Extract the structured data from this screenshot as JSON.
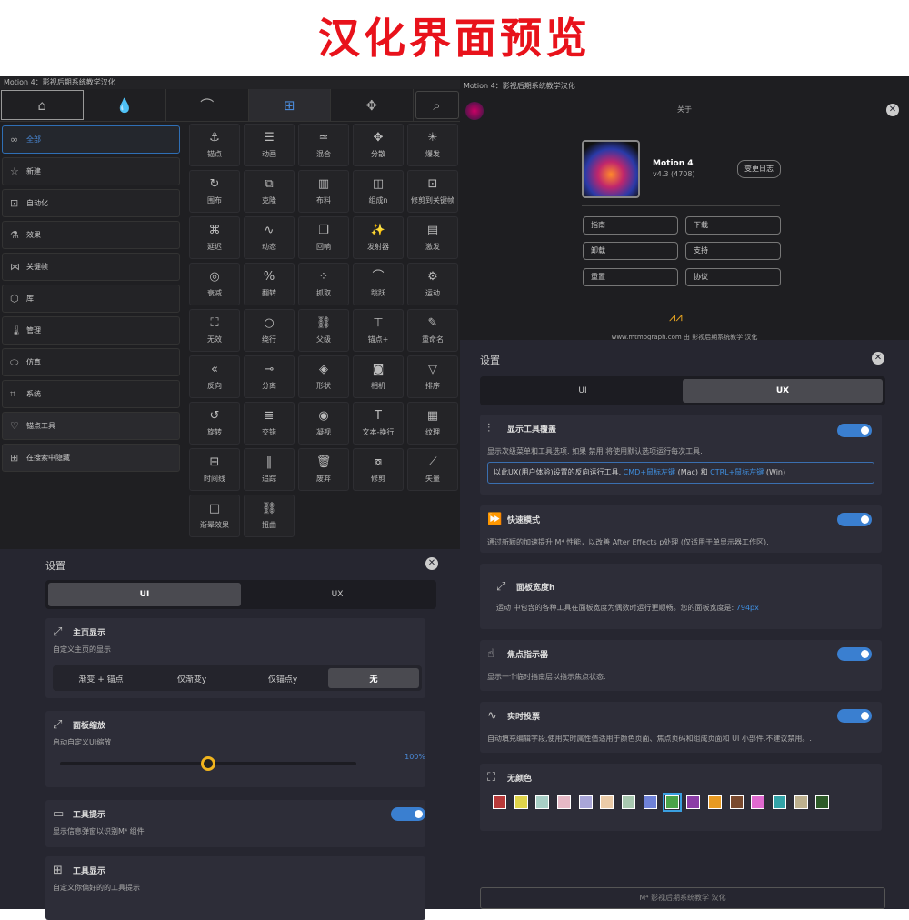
{
  "banner": {
    "title": "汉化界面预览"
  },
  "left_panel": {
    "title": "Motion 4：影视后期系统教学汉化",
    "tabs": [
      "home-icon",
      "drop-icon",
      "bezier-icon",
      "grid-icon",
      "move-icon",
      "search-icon"
    ],
    "categories": [
      {
        "label": "全部",
        "icon": "infinity-icon"
      },
      {
        "label": "新建",
        "icon": "star-icon"
      },
      {
        "label": "自动化",
        "icon": "robot-icon"
      },
      {
        "label": "效果",
        "icon": "flask-icon"
      },
      {
        "label": "关键帧",
        "icon": "keyframe-icon"
      },
      {
        "label": "库",
        "icon": "cube-icon"
      },
      {
        "label": "管理",
        "icon": "thermometer-icon"
      },
      {
        "label": "仿真",
        "icon": "pill-icon"
      },
      {
        "label": "系统",
        "icon": "gamepad-icon"
      },
      {
        "label": "锚点工具",
        "icon": "heart-icon"
      },
      {
        "label": "在搜索中隐藏",
        "icon": "grid-icon"
      }
    ],
    "tools": [
      {
        "label": "锚点",
        "glyph": "⚓"
      },
      {
        "label": "动画",
        "glyph": "☰"
      },
      {
        "label": "混合",
        "glyph": "≃"
      },
      {
        "label": "分散",
        "glyph": "✥"
      },
      {
        "label": "爆发",
        "glyph": "✳"
      },
      {
        "label": "围布",
        "glyph": "↻"
      },
      {
        "label": "克隆",
        "glyph": "⧉"
      },
      {
        "label": "布料",
        "glyph": "▥"
      },
      {
        "label": "组成n",
        "glyph": "◫"
      },
      {
        "label": "修剪到关键帧",
        "glyph": "⊡"
      },
      {
        "label": "延迟",
        "glyph": "⌘"
      },
      {
        "label": "动态",
        "glyph": "∿"
      },
      {
        "label": "回响",
        "glyph": "❐"
      },
      {
        "label": "发射器",
        "glyph": "✨"
      },
      {
        "label": "激发",
        "glyph": "▤"
      },
      {
        "label": "衰减",
        "glyph": "◎"
      },
      {
        "label": "翻转",
        "glyph": "%"
      },
      {
        "label": "抓取",
        "glyph": "⁘"
      },
      {
        "label": "跳跃",
        "glyph": "⌒"
      },
      {
        "label": "运动",
        "glyph": "⚙"
      },
      {
        "label": "无效",
        "glyph": "⛶"
      },
      {
        "label": "绕行",
        "glyph": "○"
      },
      {
        "label": "父级",
        "glyph": "⛓"
      },
      {
        "label": "锚点+",
        "glyph": "⊤"
      },
      {
        "label": "重命名",
        "glyph": "✎"
      },
      {
        "label": "反向",
        "glyph": "«"
      },
      {
        "label": "分离",
        "glyph": "⊸"
      },
      {
        "label": "形状",
        "glyph": "◈"
      },
      {
        "label": "相机",
        "glyph": "◙"
      },
      {
        "label": "排序",
        "glyph": "▽"
      },
      {
        "label": "旋转",
        "glyph": "↺"
      },
      {
        "label": "交错",
        "glyph": "≣"
      },
      {
        "label": "凝视",
        "glyph": "◉"
      },
      {
        "label": "文本-换行",
        "glyph": "T"
      },
      {
        "label": "纹理",
        "glyph": "▦"
      },
      {
        "label": "时间线",
        "glyph": "⊟"
      },
      {
        "label": "追踪",
        "glyph": "‖"
      },
      {
        "label": "废弃",
        "glyph": "🗑"
      },
      {
        "label": "修剪",
        "glyph": "⧇"
      },
      {
        "label": "矢量",
        "glyph": "⟋"
      },
      {
        "label": "渐晕效果",
        "glyph": "□"
      },
      {
        "label": "扭曲",
        "glyph": "⛓"
      }
    ]
  },
  "about": {
    "title": "Motion 4：影视后期系统教学汉化",
    "header": "关于",
    "app_name": "Motion 4",
    "version": "v4.3 (4708)",
    "changelog": "变更日志",
    "buttons": [
      "指南",
      "下载",
      "卸载",
      "支持",
      "重置",
      "协议"
    ],
    "footer": "www.mtmograph.com 由 影视后期系统教学 汉化"
  },
  "settings_left": {
    "title": "设置",
    "seg": [
      "UI",
      "UX"
    ],
    "home": {
      "title": "主页显示",
      "desc": "自定义主页的显示",
      "options": [
        "渐变 + 锚点",
        "仅渐变y",
        "仅锚点y",
        "无"
      ],
      "selected": "无"
    },
    "scale": {
      "title": "面板缩放",
      "desc": "启动自定义UI缩放",
      "value": "100%",
      "slider_fraction": 0.5
    },
    "tooltip": {
      "title": "工具提示",
      "desc": "显示信息弹窗以识别M⁴ 组件",
      "on": true
    },
    "tooldisp": {
      "title": "工具显示",
      "desc": "自定义你偏好的的工具提示"
    }
  },
  "settings_right": {
    "title": "设置",
    "seg": [
      "UI",
      "UX"
    ],
    "overlay": {
      "title": "显示工具覆盖",
      "desc": "显示次级菜单和工具选项. 如果 禁用 将使用默认选项运行每次工具.",
      "hint_pre": "以此UX(用户体验)设置的反向运行工具.",
      "hint_mac": "CMD+鼠标左键",
      "hint_mid": " (Mac) 和 ",
      "hint_win": "CTRL+鼠标左键",
      "hint_post": " (Win)",
      "on": true
    },
    "fast": {
      "title": "快速模式",
      "desc": "通过新颖的加速提升 M⁴ 性能，以改善 After Effects p处理 (仅适用于单显示器工作区).",
      "on": true
    },
    "width": {
      "title": "面板宽度h",
      "desc_pre": "运动 中包含的各种工具在面板宽度为偶数时运行更顺畅。您的面板宽度是: ",
      "value": "794px"
    },
    "focus": {
      "title": "焦点指示器",
      "desc": "显示一个临时指南层以指示焦点状态.",
      "on": true
    },
    "live": {
      "title": "实时投票",
      "desc": "自动填充编辑字段,使用实时属性值适用于颜色页面、焦点页码和组成页面和 UI 小部件.不建议禁用。.",
      "on": true
    },
    "color": {
      "title": "无颜色",
      "swatches": [
        "#b83a3a",
        "#e0d44a",
        "#a8cfc6",
        "#e6b9c6",
        "#a9a6d8",
        "#ebcba8",
        "#a8c8b0",
        "#6f82d8",
        "#4aa348",
        "#8b3da6",
        "#e89a22",
        "#7a4a2e",
        "#e06ad0",
        "#33a3a8",
        "#bdb08e",
        "#2d5a28"
      ],
      "selected": 8
    },
    "footer": "M⁴ 影视后期系统教学 汉化"
  }
}
